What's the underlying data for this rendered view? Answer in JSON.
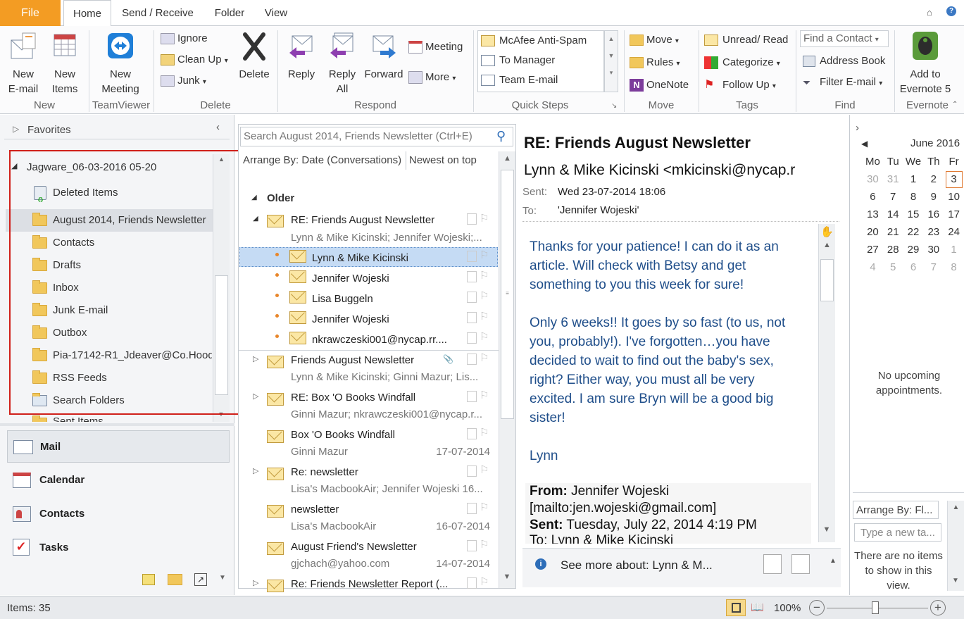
{
  "tabs": {
    "file": "File",
    "home": "Home",
    "send_receive": "Send / Receive",
    "folder": "Folder",
    "view": "View"
  },
  "ribbon": {
    "new_email": "New\nE-mail",
    "new_items": "New\nItems",
    "new_group": "New",
    "new_meeting": "New\nMeeting",
    "teamviewer_group": "TeamViewer",
    "ignore": "Ignore",
    "clean_up": "Clean Up",
    "junk": "Junk",
    "delete": "Delete",
    "delete_group": "Delete",
    "reply": "Reply",
    "reply_all": "Reply\nAll",
    "forward": "Forward",
    "meeting": "Meeting",
    "more": "More",
    "respond_group": "Respond",
    "qs_1": "McAfee Anti-Spam",
    "qs_2": "To Manager",
    "qs_3": "Team E-mail",
    "quicksteps_group": "Quick Steps",
    "move": "Move",
    "rules": "Rules",
    "onenote": "OneNote",
    "move_group": "Move",
    "unread_read": "Unread/ Read",
    "categorize": "Categorize",
    "follow_up": "Follow Up",
    "tags_group": "Tags",
    "find_contact_placeholder": "Find a Contact",
    "address_book": "Address Book",
    "filter_email": "Filter E-mail",
    "find_group": "Find",
    "add_to_evernote": "Add to\nEvernote 5",
    "evernote_group": "Evernote"
  },
  "left": {
    "favorites": "Favorites",
    "account": "Jagware_06-03-2016 05-20",
    "folders": [
      "Deleted Items",
      "August 2014, Friends Newsletter",
      "Contacts",
      "Drafts",
      "Inbox",
      "Junk E-mail",
      "Outbox",
      "Pia-17142-R1_Jdeaver@Co.Hood",
      "RSS Feeds",
      "Search Folders",
      "Sent Items"
    ],
    "nav": [
      "Mail",
      "Calendar",
      "Contacts",
      "Tasks"
    ]
  },
  "list": {
    "search_placeholder": "Search August 2014, Friends Newsletter (Ctrl+E)",
    "arrange": "Arrange By: Date (Conversations)",
    "order": "Newest on top",
    "group": "Older",
    "conv_subject": "RE: Friends August Newsletter",
    "conv_people": "Lynn & Mike Kicinski;  Jennifer Wojeski;...",
    "children": [
      "Lynn & Mike Kicinski",
      "Jennifer Wojeski",
      "Lisa Buggeln",
      "Jennifer Wojeski",
      "nkrawczeski001@nycap.rr...."
    ],
    "items": [
      {
        "subject": "Friends August Newsletter",
        "people": "Lynn & Mike Kicinski;  Ginni Mazur;  Lis...",
        "date": ""
      },
      {
        "subject": "RE: Box 'O Books Windfall",
        "people": "Ginni Mazur;  nkrawczeski001@nycap.r...",
        "date": ""
      },
      {
        "subject": "Box 'O Books Windfall",
        "people": "Ginni Mazur",
        "date": "17-07-2014"
      },
      {
        "subject": "Re: newsletter",
        "people": "Lisa's MacbookAir;  Jennifer Wojeski  16...",
        "date": ""
      },
      {
        "subject": "newsletter",
        "people": "Lisa's MacbookAir",
        "date": "16-07-2014"
      },
      {
        "subject": "August Friend's Newsletter",
        "people": "gjchach@yahoo.com",
        "date": "14-07-2014"
      },
      {
        "subject": "Re: Friends Newsletter Report (...",
        "people": "",
        "date": ""
      }
    ]
  },
  "reading": {
    "subject": "RE: Friends August Newsletter",
    "from": "Lynn & Mike Kicinski <mkicinski@nycap.r",
    "sent_label": "Sent:",
    "sent": "Wed 23-07-2014 18:06",
    "to_label": "To:",
    "to": "'Jennifer Wojeski'",
    "p1": [
      "Thanks for your patience!  I can do it as an",
      "article.  Will check with Betsy and get",
      "something to you this week for sure!"
    ],
    "p2": [
      "Only 6 weeks!!  It goes by so fast (to us, not",
      "you, probably!).  I've forgotten…you have",
      "decided to wait to find out the baby's sex,",
      "right?  Either way, you must all be very",
      "excited.  I am sure Bryn will be a good big",
      "sister!"
    ],
    "sig": "Lynn",
    "q_from_label": "From:",
    "q_from": " Jennifer Wojeski",
    "q_mailto": "[mailto:jen.wojeski@gmail.com]",
    "q_sent_label": "Sent:",
    "q_sent": " Tuesday, July 22, 2014 4:19 PM",
    "q_to": "To: Lynn & Mike Kicinski",
    "see_more": "See more about: Lynn & M..."
  },
  "todo": {
    "month": "June 2016",
    "days": [
      "Mo",
      "Tu",
      "We",
      "Th",
      "Fr"
    ],
    "weeks": [
      [
        "30",
        "31",
        "1",
        "2",
        "3"
      ],
      [
        "6",
        "7",
        "8",
        "9",
        "10"
      ],
      [
        "13",
        "14",
        "15",
        "16",
        "17"
      ],
      [
        "20",
        "21",
        "22",
        "23",
        "24"
      ],
      [
        "27",
        "28",
        "29",
        "30",
        "1"
      ],
      [
        "4",
        "5",
        "6",
        "7",
        "8"
      ]
    ],
    "no_appts": "No upcoming appointments.",
    "arrange": "Arrange By: Fl...",
    "new_task": "Type a new ta...",
    "no_items": "There are no items to show in this view."
  },
  "status": {
    "items": "Items: 35",
    "zoom": "100%"
  }
}
